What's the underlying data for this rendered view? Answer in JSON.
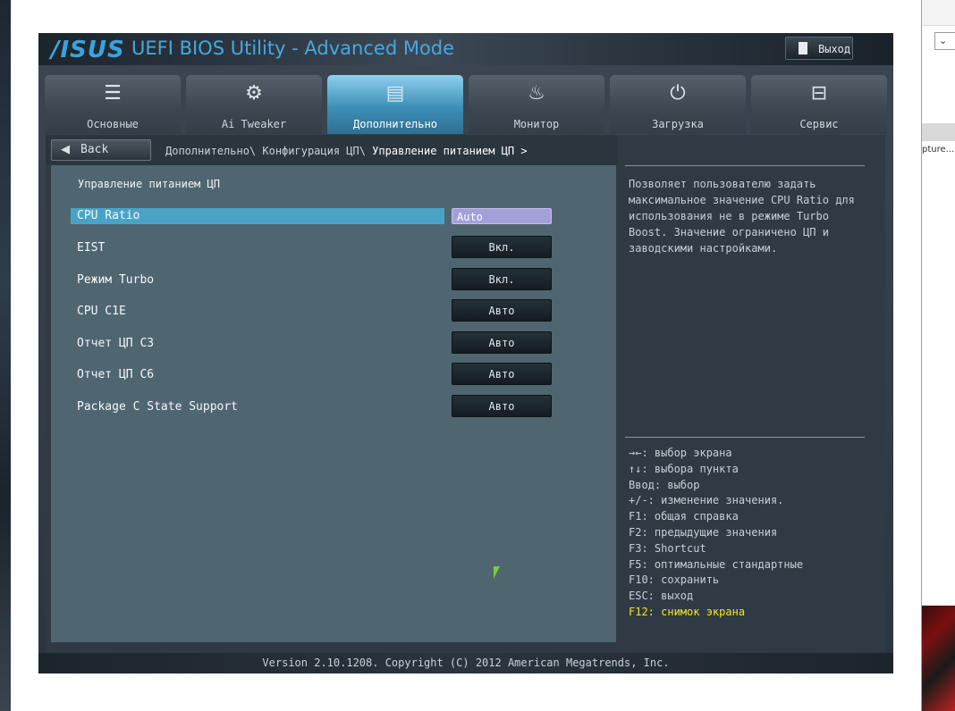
{
  "window": {
    "logo": "/ISUS",
    "title": "UEFI BIOS Utility - Advanced Mode",
    "exit_label": "Выход"
  },
  "tabs": [
    {
      "label": "Основные",
      "icon": "list-icon",
      "glyph": "☰"
    },
    {
      "label": "Ai Tweaker",
      "icon": "tweaker-icon",
      "glyph": "⚙"
    },
    {
      "label": "Дополнительно",
      "icon": "advanced-icon",
      "glyph": "▤"
    },
    {
      "label": "Монитор",
      "icon": "monitor-icon",
      "glyph": "♨"
    },
    {
      "label": "Загрузка",
      "icon": "power-icon",
      "glyph": "⏻"
    },
    {
      "label": "Сервис",
      "icon": "tool-icon",
      "glyph": "⊟"
    }
  ],
  "active_tab": "Дополнительно",
  "nav": {
    "back_label": "Back",
    "breadcrumb_path": "Дополнительно\\ Конфигурация ЦП\\",
    "breadcrumb_current": "Управление питанием ЦП >"
  },
  "section_title": "Управление питанием ЦП",
  "settings": [
    {
      "name": "CPU Ratio",
      "value": "Auto"
    },
    {
      "name": "EIST",
      "value": "Вкл."
    },
    {
      "name": "Режим Turbo",
      "value": "Вкл."
    },
    {
      "name": "CPU C1E",
      "value": "Авто"
    },
    {
      "name": "Отчет ЦП C3",
      "value": "Авто"
    },
    {
      "name": "Отчет ЦП C6",
      "value": "Авто"
    },
    {
      "name": "Package C State Support",
      "value": "Авто"
    }
  ],
  "help": {
    "description": "Позволяет пользователю задать максимальное значение CPU Ratio для использования не в режиме Turbo Boost. Значение ограничено ЦП и заводскими настройками.",
    "keys": [
      "→←: выбор экрана",
      "↑↓: выбора пункта",
      "Ввод: выбор",
      "+/-: изменение значения.",
      "F1: общая справка",
      "F2: предыдущие значения",
      "F3: Shortcut",
      "F5: оптимальные стандартные",
      "F10: сохранить",
      "ESC: выход"
    ],
    "highlight_key": "F12: снимок экрана"
  },
  "footer": "Version 2.10.1208. Copyright (C) 2012 American Megatrends, Inc.",
  "background_app": {
    "caption": "pture..."
  },
  "colors": {
    "accent": "#48a8de",
    "selected_row": "#4aa3c6",
    "selected_value": "#a59fd8",
    "highlight_key": "#f4e820"
  }
}
